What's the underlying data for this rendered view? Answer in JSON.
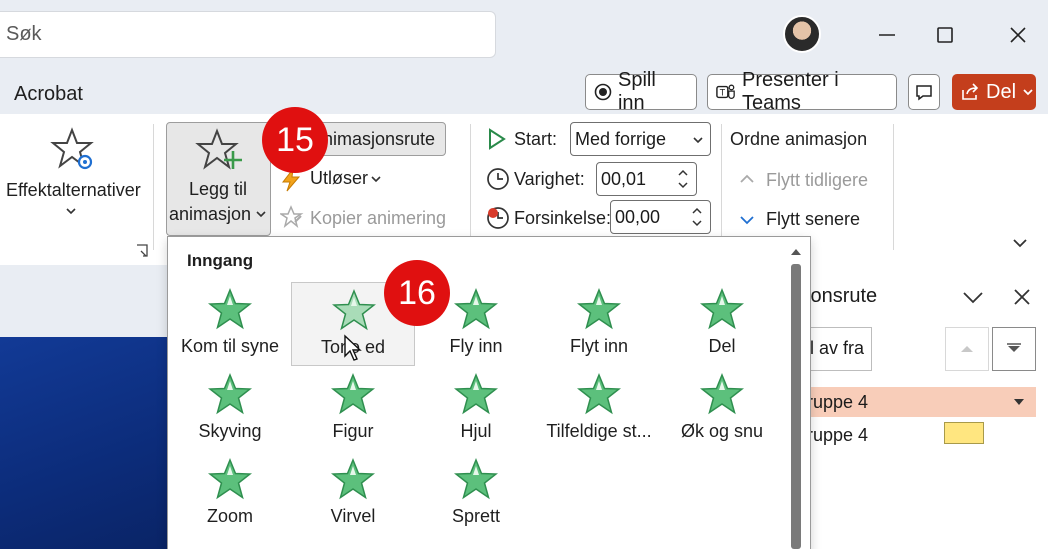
{
  "titlebar": {
    "search_placeholder": "Søk"
  },
  "tabs": {
    "acrobat": "Acrobat"
  },
  "actions": {
    "record": "Spill inn",
    "present_teams": "Presenter i Teams",
    "share": "Del"
  },
  "ribbon": {
    "effect_options": "Effektalternativer",
    "add_animation_line1": "Legg til",
    "add_animation_line2": "animasjon",
    "animation_pane": "nimasjonsrute",
    "trigger": "Utløser",
    "copy_animation": "Kopier animering",
    "start_label": "Start:",
    "start_value": "Med forrige",
    "duration_label": "Varighet:",
    "duration_value": "00,01",
    "delay_label": "Forsinkelse:",
    "delay_value": "00,00",
    "reorder_title": "Ordne animasjon",
    "move_earlier": "Flytt tidligere",
    "move_later": "Flytt senere"
  },
  "gallery": {
    "section": "Inngang",
    "items": [
      {
        "label": "Kom til syne",
        "icon": "appear-star-icon"
      },
      {
        "label": "Tone ed",
        "icon": "fade-star-icon"
      },
      {
        "label": "Fly inn",
        "icon": "fly-in-star-icon"
      },
      {
        "label": "Flyt inn",
        "icon": "float-in-star-icon"
      },
      {
        "label": "Del",
        "icon": "split-star-icon"
      },
      {
        "label": "Skyving",
        "icon": "wipe-star-icon"
      },
      {
        "label": "Figur",
        "icon": "shape-star-icon"
      },
      {
        "label": "Hjul",
        "icon": "wheel-star-icon"
      },
      {
        "label": "Tilfeldige st...",
        "icon": "random-bars-star-icon"
      },
      {
        "label": "Øk og snu",
        "icon": "grow-turn-star-icon"
      },
      {
        "label": "Zoom",
        "icon": "zoom-star-icon"
      },
      {
        "label": "Virvel",
        "icon": "swivel-star-icon"
      },
      {
        "label": "Sprett",
        "icon": "bounce-star-icon"
      }
    ]
  },
  "badges": {
    "step15": "15",
    "step16": "16"
  },
  "pane": {
    "title": "sjonsrute",
    "play_from": "l av fra",
    "row1": "ruppe 4",
    "row2": "ruppe 4"
  },
  "colors": {
    "share": "#c43e1c",
    "badge": "#e01010",
    "selected_row": "#f8cdb9",
    "timeline_bar": "#ffe680",
    "star_green": "#3cb371"
  }
}
